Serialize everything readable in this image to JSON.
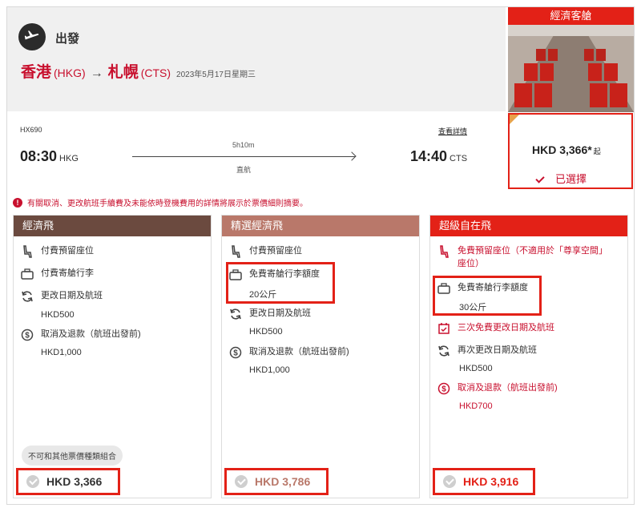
{
  "header": {
    "depart_label": "出發",
    "origin_city": "香港",
    "origin_code": "(HKG)",
    "arrow": "→",
    "dest_city": "札幌",
    "dest_code": "(CTS)",
    "date": "2023年5月17日星期三"
  },
  "cabin": {
    "title": "經濟客艙",
    "price": "HKD 3,366*",
    "price_suffix": "起",
    "selected_label": "已選擇"
  },
  "flight": {
    "number": "HX690",
    "details_link": "查看詳情",
    "depart_time": "08:30",
    "depart_code": "HKG",
    "arrive_time": "14:40",
    "arrive_code": "CTS",
    "duration": "5h10m",
    "stops": "直航"
  },
  "notice": "有關取消、更改航班手續費及未能依時登機費用的詳情將展示於票價細則摘要。",
  "fares": [
    {
      "name": "經濟飛",
      "header_color": "#6b4a3f",
      "seat": "付費預留座位",
      "baggage": "付費寄艙行李",
      "change": "更改日期及航班",
      "change_fee": "HKD500",
      "refund": "取消及退款（航班出發前)",
      "refund_fee": "HKD1,000",
      "combine_note": "不可和其他票價種類組合",
      "price": "HKD 3,366",
      "price_color": "#333333"
    },
    {
      "name": "精選經濟飛",
      "header_color": "#b9786a",
      "seat": "付費預留座位",
      "baggage": "免費寄艙行李額度",
      "baggage_amount": "20公斤",
      "change": "更改日期及航班",
      "change_fee": "HKD500",
      "refund": "取消及退款（航班出發前)",
      "refund_fee": "HKD1,000",
      "price": "HKD 3,786",
      "price_color": "#b9786a"
    },
    {
      "name": "超級自在飛",
      "header_color": "#e32117",
      "seat_line1": "免費預留座位（不適用於「尊享空間」",
      "seat_line2": "座位）",
      "baggage": "免費寄艙行李額度",
      "baggage_amount": "30公斤",
      "free_change": "三次免費更改日期及航班",
      "change": "再次更改日期及航班",
      "change_fee": "HKD500",
      "refund": "取消及退款（航班出發前)",
      "refund_fee": "HKD700",
      "price": "HKD 3,916",
      "price_color": "#e32117"
    }
  ],
  "icons": {
    "plane": "airplane-icon",
    "seat": "seat-icon",
    "baggage": "suitcase-icon",
    "change": "refresh-icon",
    "refund": "dollar-refund-icon",
    "calendar": "calendar-check-icon"
  }
}
